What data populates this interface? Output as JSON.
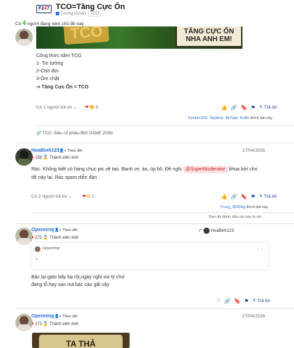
{
  "header": {
    "logo": {
      "left": "F2",
      "four": "4",
      "right": "7"
    },
    "title": "TCO=Tăng Cực Ổn",
    "category": "Chứng khoán",
    "tag": "TCO",
    "viewers_prefix": "Có",
    "viewers_count": "4",
    "viewers_suffix": "người đang xem chủ đề này"
  },
  "post1": {
    "image_text_left": "TCO",
    "image_text_sign": "TĂNG CỰC ỔN NHA ANH EM!",
    "lines": [
      "Công thức nắm TCO",
      "1- Tin tưởng",
      "2-Chờ đợi",
      "3-Ôm chặt",
      "➔ Tăng Cực Ổn = TCO"
    ],
    "replies": "Có 1 người trả lời",
    "reactions_count": "5",
    "reply_label": "Trả lời",
    "likes_names": "Kenken222, Skyblue, Mr.NaK, BoBo",
    "likes_suffix": "thích bài này",
    "topic_link": "TCO -Siêu cổ phiếu-BIG GAME 2026!"
  },
  "post2": {
    "username": "HoaBinh123",
    "follow": "Theo dõi",
    "score": "159",
    "rank": "Thành viên mới",
    "date": "27/04/2026",
    "text_line1_a": "Rác. Không biết có hàng chục pic về tao. Banh ve, ảo, úp bô. Đề nghị",
    "mention": "@SuperModerator",
    "text_line1_b": "khoa bớt cho",
    "text_line2": "dề này lại. Rác spam diễn đàn",
    "replies": "Có 2 người trả lời",
    "reactions_count": "2",
    "reply_label": "Trả lời",
    "likes_name": "Trung_3000Kg",
    "likes_suffix": "thích bài này",
    "notice": "Bạn đã đánh dấu cái này là rác"
  },
  "post3": {
    "username": "Openning",
    "follow": "Theo dõi",
    "score": "272",
    "rank": "Thành viên mới",
    "reply_to": "HoaBinh123",
    "quote_user": "Openning:",
    "quote_body": "*",
    "text_line1": "Bác lại gato bây bạ rồi,ngày nghỉ vui tý chứ",
    "text_line2": "đang lỗ hay sao mà bác cáu gắt vậy",
    "reply_label": "Trả lời"
  },
  "post4": {
    "username": "Openning",
    "follow": "Theo dõi",
    "score": "272",
    "rank": "Thành viên mới",
    "date": "27/04/2026",
    "image_text": "TA THẢ"
  }
}
